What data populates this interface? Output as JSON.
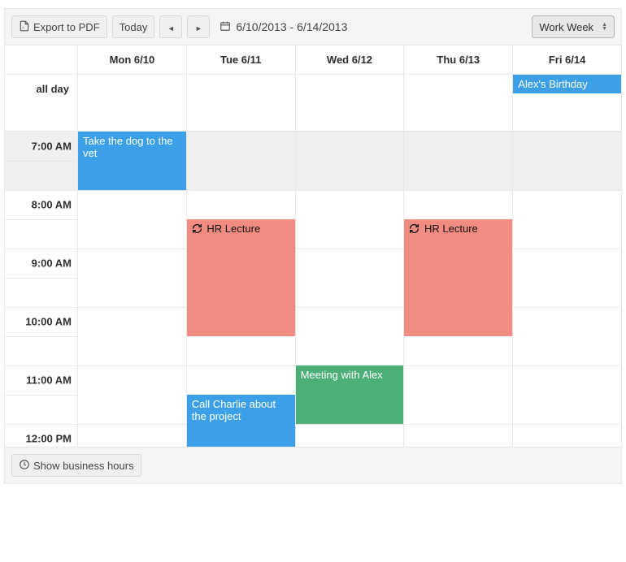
{
  "toolbar": {
    "export_label": "Export to PDF",
    "today_label": "Today",
    "date_range": "6/10/2013 - 6/14/2013",
    "view_selected": "Work Week"
  },
  "columns": {
    "allday_label": "all day",
    "days": [
      {
        "label": "Mon 6/10"
      },
      {
        "label": "Tue 6/11"
      },
      {
        "label": "Wed 6/12"
      },
      {
        "label": "Thu 6/13"
      },
      {
        "label": "Fri 6/14"
      }
    ]
  },
  "time_labels": {
    "t0": "7:00 AM",
    "t1": "8:00 AM",
    "t2": "9:00 AM",
    "t3": "10:00 AM",
    "t4": "11:00 AM",
    "t5": "12:00 PM"
  },
  "events": {
    "dog_vet": {
      "title": "Take the dog to the vet",
      "day": 0,
      "start": "7:00 AM",
      "end": "8:00 AM",
      "color": "blue"
    },
    "hr_tue": {
      "title": "HR Lecture",
      "day": 1,
      "start": "8:30 AM",
      "end": "10:30 AM",
      "color": "red",
      "recurring": true
    },
    "hr_thu": {
      "title": "HR Lecture",
      "day": 3,
      "start": "8:30 AM",
      "end": "10:30 AM",
      "color": "red",
      "recurring": true
    },
    "meeting_alex": {
      "title": "Meeting with Alex",
      "day": 2,
      "start": "10:30 AM",
      "end": "11:30 AM",
      "color": "green"
    },
    "call_charlie": {
      "title": "Call Charlie about the project",
      "day": 1,
      "start": "11:30 AM",
      "end": "1:00 PM",
      "color": "blue"
    },
    "alex_birthday": {
      "title": "Alex's Birthday",
      "day": 4,
      "allday": true,
      "color": "blue"
    }
  },
  "footer": {
    "business_hours_label": "Show business hours"
  }
}
